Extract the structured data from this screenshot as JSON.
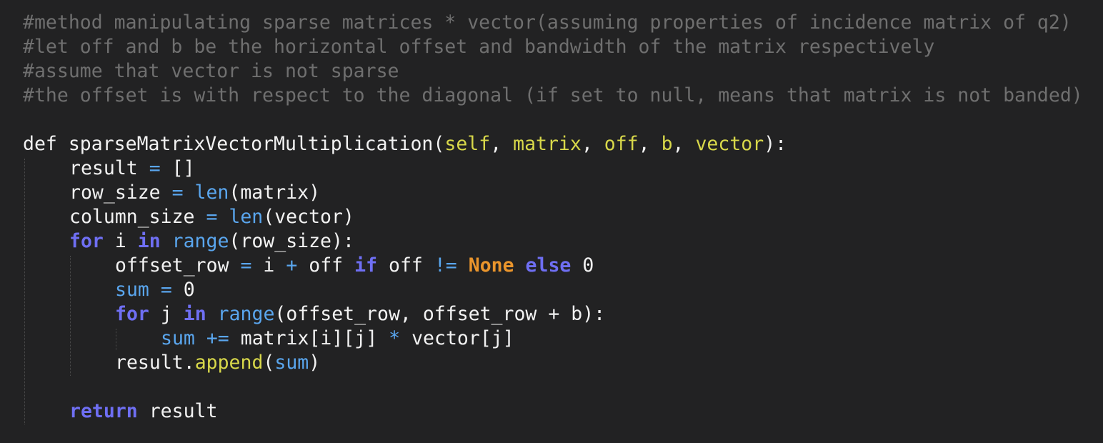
{
  "code": {
    "comments": [
      "#method manipulating sparse matrices * vector(assuming properties of incidence matrix of q2)",
      "#let off and b be the horizontal offset and bandwidth of the matrix respectively",
      "#assume that vector is not sparse",
      "#the offset is with respect to the diagonal (if set to null, means that matrix is not banded)"
    ],
    "def_kw": "def",
    "func_name": "sparseMatrixVectorMultiplication",
    "open_paren": "(",
    "params": [
      "self",
      "matrix",
      "off",
      "b",
      "vector"
    ],
    "sep": ", ",
    "close_sig": "):",
    "result_var": "result",
    "assign_op": " = ",
    "empty_list": "[]",
    "row_size_var": "row_size",
    "len_fn": "len",
    "matrix_arg": "(matrix)",
    "column_size_var": "column_size",
    "vector_arg": "(vector)",
    "for_kw": "for",
    "in_kw": "in",
    "range_fn": "range",
    "loop_i": " i ",
    "row_size_arg": "(row_size):",
    "offset_row_var": "offset_row",
    "i_token": "i",
    "plus_op": " + ",
    "off_token": "off",
    "if_kw": "if",
    "neq_op": "!=",
    "none_const": "None",
    "else_kw": "else",
    "zero": "0",
    "sum_var": "sum",
    "loop_j": " j ",
    "range_args_j": "(offset_row, offset_row + b):",
    "plus_assign_op": "+=",
    "matrix_index": "matrix[i][j]",
    "mul_op": "*",
    "vector_index": "vector[j]",
    "result_dot": "result.",
    "append_fn": "append",
    "append_args_open": "(",
    "append_args_close": ")",
    "return_kw": "return"
  },
  "colors": {
    "background": "#222223",
    "comment": "#6f6f6f",
    "keyword": "#6f6ff3",
    "parameter": "#d8d84a",
    "builtin": "#5aa6ee",
    "constant": "#ea952c",
    "text": "#f2f2f2"
  }
}
